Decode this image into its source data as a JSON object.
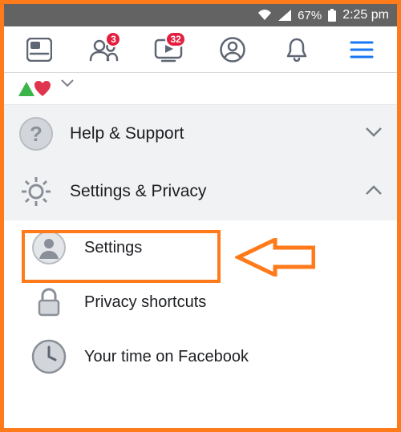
{
  "status": {
    "battery_pct": "67%",
    "time": "2:25 pm"
  },
  "tabs": {
    "friends_badge": "3",
    "watch_badge": "32"
  },
  "see_more": {
    "label": "• • •    • • •  •  •",
    "chevron": "⌄"
  },
  "menu": {
    "help_support": {
      "label": "Help & Support"
    },
    "settings_privacy": {
      "label": "Settings & Privacy"
    },
    "settings": {
      "label": "Settings"
    },
    "privacy_shortcuts": {
      "label": "Privacy shortcuts"
    },
    "your_time": {
      "label": "Your time on Facebook"
    }
  }
}
